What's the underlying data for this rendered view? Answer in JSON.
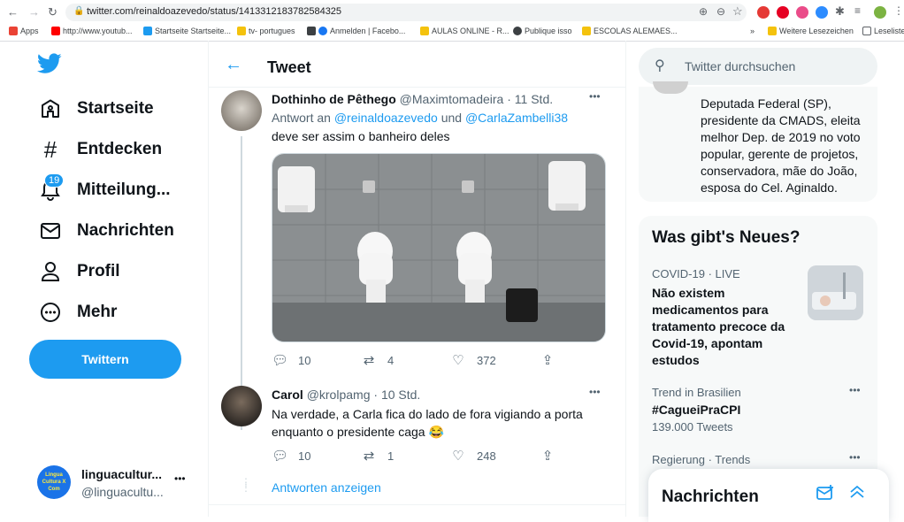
{
  "browser": {
    "url": "twitter.com/reinaldoazevedo/status/1413312183782584325",
    "bookmarks": [
      {
        "label": "Apps",
        "color": "#ea4335"
      },
      {
        "label": "http://www.youtub...",
        "color": "#ff0000"
      },
      {
        "label": "Startseite Startseite...",
        "color": "#1d9bf0"
      },
      {
        "label": "tv- portugues",
        "color": "#f4c20d"
      },
      {
        "label": "Anmelden | Facebo...",
        "color": "#1877f2"
      },
      {
        "label": "AULAS ONLINE - R...",
        "color": "#f4c20d"
      },
      {
        "label": "Publique isso",
        "color": "#3c4043"
      },
      {
        "label": "ESCOLAS ALEMAES...",
        "color": "#f4c20d"
      }
    ],
    "bookmarks_more": "»",
    "other_bookmarks": "Weitere Lesezeichen",
    "reading_list": "Leseliste"
  },
  "nav": {
    "items": [
      {
        "label": "Startseite",
        "icon": "home-icon"
      },
      {
        "label": "Entdecken",
        "icon": "hashtag-icon"
      },
      {
        "label": "Mitteilung...",
        "icon": "bell-icon"
      },
      {
        "label": "Nachrichten",
        "icon": "mail-icon"
      },
      {
        "label": "Profil",
        "icon": "profile-icon"
      },
      {
        "label": "Mehr",
        "icon": "more-icon"
      }
    ],
    "notification_badge": "19",
    "tweet_button": "Twittern",
    "account": {
      "name": "linguacultur...",
      "handle": "@linguacultu...",
      "avatar_text": "Lingua Cultura X Com",
      "more": "•••"
    }
  },
  "header": {
    "title": "Tweet"
  },
  "tweets": [
    {
      "name": "Dothinho de Pêthego",
      "handle": "@Maximtomadeira",
      "sep": "·",
      "time": "11 Std.",
      "reply_prefix": "Antwort an",
      "reply_to_1": "@reinaldoazevedo",
      "reply_and": "und",
      "reply_to_2": "@CarlaZambelli38",
      "text": "deve ser assim o banheiro deles",
      "replies": "10",
      "retweets": "4",
      "likes": "372"
    },
    {
      "name": "Carol",
      "handle": "@krolpamg",
      "sep": "·",
      "time": "10 Std.",
      "text": "Na verdade, a Carla fica do lado de fora vigiando a porta enquanto o presidente caga 😂",
      "replies": "10",
      "retweets": "1",
      "likes": "248"
    }
  ],
  "show_replies": "Antworten anzeigen",
  "search": {
    "placeholder": "Twitter durchsuchen"
  },
  "bio": {
    "text": "Deputada Federal (SP), presidente da CMADS, eleita melhor Dep. de 2019 no voto popular, gerente de projetos, conservadora, mãe do João, esposa do Cel. Aginaldo."
  },
  "trends": {
    "title": "Was gibt's Neues?",
    "items": [
      {
        "context": "COVID-19 · LIVE",
        "headline": "Não existem medicamentos para tratamento precoce da Covid-19, apontam estudos"
      },
      {
        "context": "Trend in Brasilien",
        "tag": "#CagueiPraCPI",
        "count": "139.000 Tweets",
        "more": "•••"
      },
      {
        "context": "Regierung · Trends",
        "tag": "#...",
        "more": "•••"
      }
    ]
  },
  "messages_drawer": {
    "title": "Nachrichten"
  },
  "colors": {
    "accent": "#1d9bf0",
    "text": "#0f1419",
    "muted": "#536471",
    "panel": "#f7f9f9"
  }
}
